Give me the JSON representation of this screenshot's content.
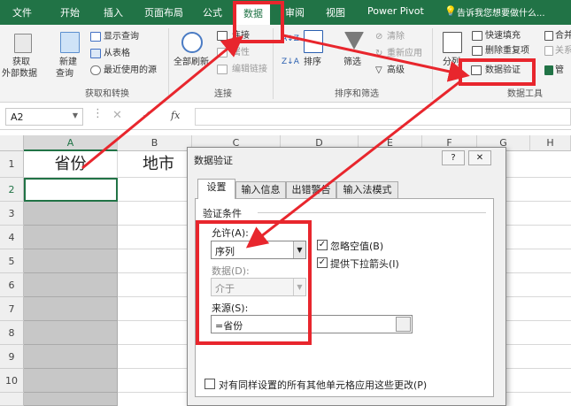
{
  "tabs": [
    "文件",
    "开始",
    "插入",
    "页面布局",
    "公式",
    "数据",
    "审阅",
    "视图",
    "Power Pivot"
  ],
  "active_tab": "数据",
  "tell_me": "告诉我您想要做什么...",
  "ribbon": {
    "get_external_l1": "获取",
    "get_external_l2": "外部数据",
    "new_query_l1": "新建",
    "new_query_l2": "查询",
    "show_query": "显示查询",
    "from_table": "从表格",
    "recent_sources": "最近使用的源",
    "group_get_transform": "获取和转换",
    "refresh_all": "全部刷新",
    "connections": "连接",
    "properties": "属性",
    "edit_links": "编辑链接",
    "group_connections": "连接",
    "sort": "排序",
    "filter": "筛选",
    "clear": "清除",
    "reapply": "重新应用",
    "advanced": "高级",
    "group_sort_filter": "排序和筛选",
    "split": "分列",
    "flash_fill": "快速填充",
    "remove_dup": "删除重复项",
    "data_validation": "数据验证",
    "consolidate": "合并",
    "relationships": "关系",
    "manage": "管",
    "group_data_tools": "数据工具"
  },
  "formula_bar": {
    "name_box": "A2",
    "fx": "fx"
  },
  "columns": [
    "A",
    "B",
    "C",
    "D",
    "E",
    "F",
    "G",
    "H"
  ],
  "rows": [
    "1",
    "2",
    "3",
    "4",
    "5",
    "6",
    "7",
    "8",
    "9",
    "10"
  ],
  "cells": {
    "A1": "省份",
    "B1": "地市"
  },
  "dialog": {
    "title": "数据验证",
    "help": "?",
    "tabs": [
      "设置",
      "输入信息",
      "出错警告",
      "输入法模式"
    ],
    "criteria_label": "验证条件",
    "allow_label": "允许(A):",
    "allow_value": "序列",
    "ignore_blank": "忽略空值(B)",
    "dropdown": "提供下拉箭头(I)",
    "data_label": "数据(D):",
    "data_value": "介于",
    "source_label": "来源(S):",
    "source_value": "=省份",
    "apply_all": "对有同样设置的所有其他单元格应用这些更改(P)"
  },
  "colors": {
    "excel_green": "#217346",
    "highlight_red": "#e8262d"
  }
}
